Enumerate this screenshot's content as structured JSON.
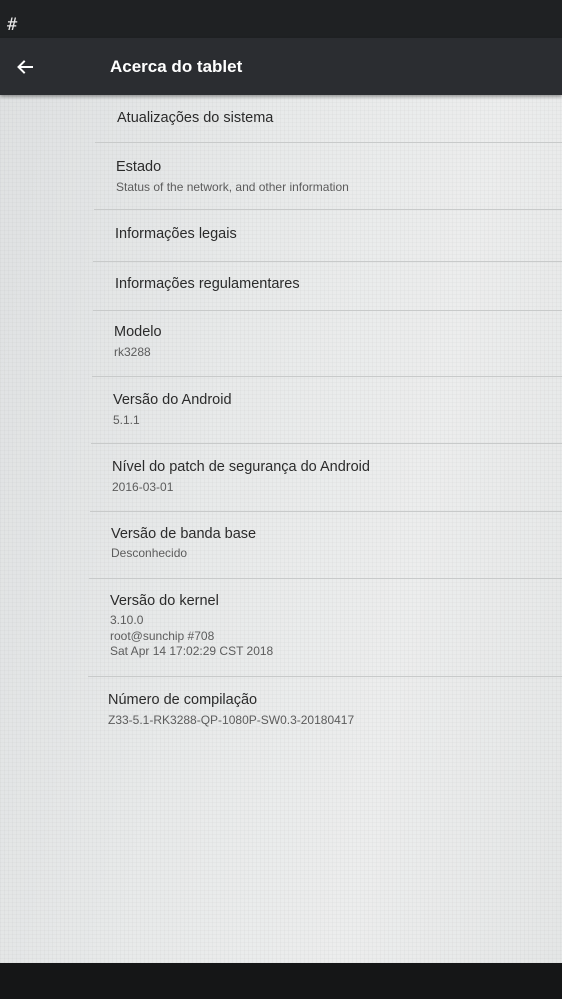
{
  "status_bar": {
    "notification": "#"
  },
  "app_bar": {
    "title": "Acerca do tablet"
  },
  "items": [
    {
      "title": "Atualizações do sistema"
    },
    {
      "title": "Estado",
      "subtitle": "Status of the network, and other information"
    },
    {
      "title": "Informações legais"
    },
    {
      "title": "Informações regulamentares"
    },
    {
      "title": "Modelo",
      "subtitle": "rk3288"
    },
    {
      "title": "Versão do Android",
      "subtitle": "5.1.1"
    },
    {
      "title": "Nível do patch de segurança do Android",
      "subtitle": "2016-03-01"
    },
    {
      "title": "Versão de banda base",
      "subtitle": "Desconhecido"
    },
    {
      "title": "Versão do kernel",
      "subtitle_lines": [
        "3.10.0",
        "root@sunchip #708",
        "Sat Apr 14 17:02:29 CST 2018"
      ]
    },
    {
      "title": "Número de compilação",
      "subtitle": "Z33-5.1-RK3288-QP-1080P-SW0.3-20180417"
    }
  ]
}
